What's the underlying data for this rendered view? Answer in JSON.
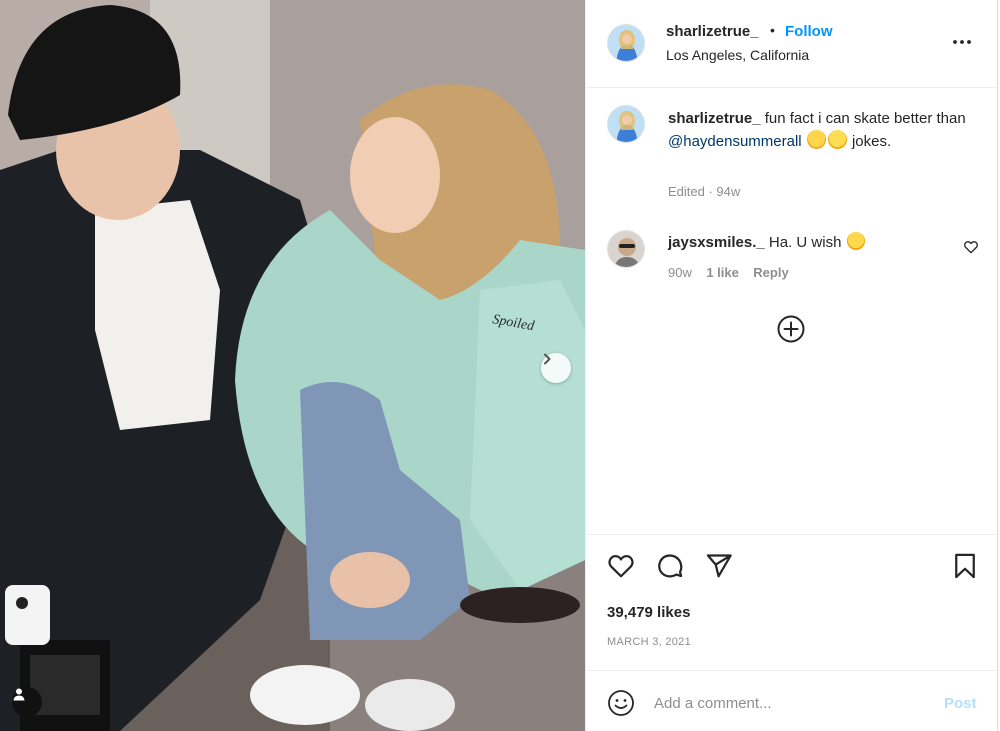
{
  "photo": {
    "jacket_patch_text": "Spoiled",
    "next_icon": "chevron-right-icon",
    "tag_icon": "user-tag-icon"
  },
  "header": {
    "username": "sharlizetrue_",
    "separator": "•",
    "follow_label": "Follow",
    "location": "Los Angeles, California",
    "more_icon": "more-options-icon"
  },
  "caption": {
    "username": "sharlizetrue_",
    "text_before": "fun fact i can skate better than",
    "mention": "@haydensummerall",
    "text_after": "jokes.",
    "meta": "Edited · 94w"
  },
  "reply": {
    "username": "jaysxsmiles._",
    "text": "Ha. U wish",
    "time": "90w",
    "likes": "1 like",
    "reply_label": "Reply"
  },
  "actions": {
    "like_icon": "heart-icon",
    "comment_icon": "comment-icon",
    "share_icon": "share-icon",
    "save_icon": "bookmark-icon",
    "likes_text": "39,479 likes",
    "date": "MARCH 3, 2021"
  },
  "add_comment": {
    "placeholder": "Add a comment...",
    "post_label": "Post",
    "emoji_icon": "emoji-icon"
  },
  "colors": {
    "accent": "#0095f6",
    "mention": "#00376b",
    "muted": "#8e8e8e",
    "post_disabled": "#b2dffc"
  }
}
